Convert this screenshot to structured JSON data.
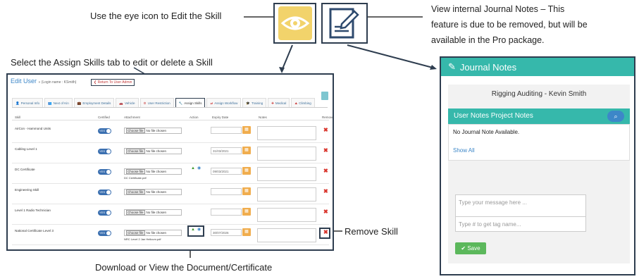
{
  "callouts": {
    "eye": "Use the eye icon to Edit the Skill",
    "assign": "Select the Assign Skills tab to edit or delete a Skill",
    "journal_line1": "View internal Journal Notes – This",
    "journal_line2": "feature is due to be removed, but will be",
    "journal_line3": "available in the Pro package.",
    "remove": "Remove Skill",
    "download": "Download or View the Document/Certificate"
  },
  "icons": {
    "eye_icon": "eye-icon",
    "journal_icon": "edit-note-icon"
  },
  "colors": {
    "eye_bg": "#f2d36b",
    "teal": "#36b8ab",
    "accent": "#3d87c8",
    "danger": "#d9342b",
    "frame": "#2e3d4f"
  },
  "edit_user": {
    "title": "Edit User",
    "login_name": "» (Login name : KSmith)",
    "return_link": "❮ Return To User Admin",
    "tabs": [
      {
        "icon": "👤",
        "label": "Personal Info"
      },
      {
        "icon": "👥",
        "label": "Next of Kin"
      },
      {
        "icon": "💼",
        "label": "Employment Details"
      },
      {
        "icon": "🚗",
        "label": "Vehicle"
      },
      {
        "icon": "⚙",
        "label": "User Restriction"
      },
      {
        "icon": "🔧",
        "label": "Assign Skills"
      },
      {
        "icon": "⇄",
        "label": "Assign Workflow"
      },
      {
        "icon": "🎓",
        "label": "Training"
      },
      {
        "icon": "✚",
        "label": "Medical"
      },
      {
        "icon": "⛰",
        "label": "Climbing"
      }
    ],
    "columns": [
      "Skill",
      "Certified",
      "Attachment",
      "Action",
      "Expiry Date",
      "Notes",
      "Remove"
    ],
    "toggle_label": "YES",
    "choose_file": "Choose file",
    "no_file": "No file chosen",
    "rows": [
      {
        "skill": "AirCon - Hammond Units",
        "date": "",
        "filename": ""
      },
      {
        "skill": "Cabling Level 1",
        "date": "31/03/2021",
        "filename": ""
      },
      {
        "skill": "DC Certificate",
        "date": "09/03/2021",
        "filename": "DC Certificate.pdf"
      },
      {
        "skill": "Engineering Skill",
        "date": "",
        "filename": ""
      },
      {
        "skill": "Level 1 Radio Technician",
        "date": "",
        "filename": ""
      },
      {
        "skill": "National Certificate Level 3",
        "date": "30/07/2026",
        "filename": "NRC Level 2 Jan Helicum.pdf"
      }
    ]
  },
  "journal": {
    "title": "Journal Notes",
    "subject": "Rigging Auditing - Kevin Smith",
    "tabs_label": "User Notes Project Notes",
    "empty_text": "No Journal Note Available.",
    "show_all": "Show All",
    "message_placeholder": "Type your message here ...",
    "tag_placeholder": "Type # to get tag name...",
    "save_label": "Save"
  }
}
